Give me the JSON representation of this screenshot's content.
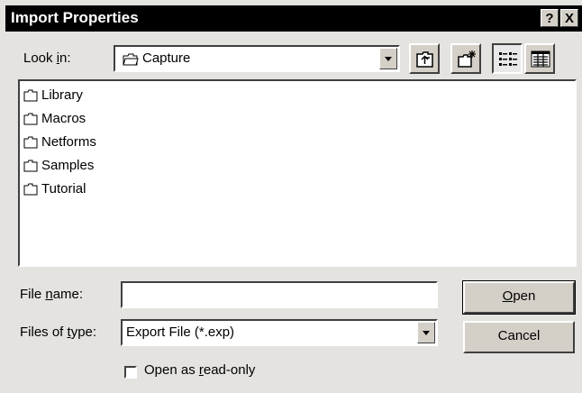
{
  "window": {
    "title": "Import Properties",
    "help_button": "?",
    "close_button": "X"
  },
  "look_in": {
    "label_pre": "Look ",
    "label_hot": "i",
    "label_post": "n:",
    "value": "Capture"
  },
  "toolbar": {
    "buttons": [
      {
        "name": "up-one-level",
        "icon": "folder-up-icon"
      },
      {
        "name": "create-new-folder",
        "icon": "new-folder-icon"
      },
      {
        "name": "list-view",
        "icon": "list-view-icon",
        "pressed": true
      },
      {
        "name": "details-view",
        "icon": "details-view-icon"
      }
    ]
  },
  "folders": [
    {
      "name": "Library"
    },
    {
      "name": "Macros"
    },
    {
      "name": "Netforms"
    },
    {
      "name": "Samples"
    },
    {
      "name": "Tutorial"
    }
  ],
  "file_name": {
    "label_pre": "File ",
    "label_hot": "n",
    "label_post": "ame:",
    "value": ""
  },
  "files_of_type": {
    "label_pre": "Files of ",
    "label_hot": "t",
    "label_post": "ype:",
    "value": "Export File (*.exp)"
  },
  "buttons": {
    "open_hot": "O",
    "open_rest": "pen",
    "cancel": "Cancel"
  },
  "read_only": {
    "label_pre": "Open as ",
    "label_hot": "r",
    "label_post": "ead-only",
    "checked": false
  }
}
